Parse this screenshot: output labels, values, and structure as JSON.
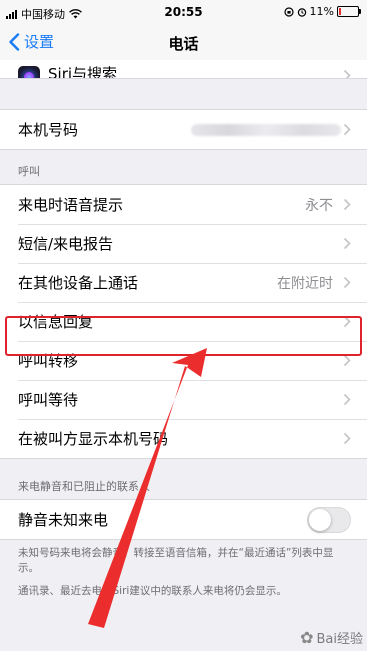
{
  "status_bar": {
    "carrier": "中国移动",
    "time": "20:55",
    "battery_percent": "11%",
    "battery_level": 0.11,
    "battery_color": "#e03030"
  },
  "nav": {
    "back_label": "设置",
    "title": "电话"
  },
  "top_group": {
    "siri_row_label": "Siri与搜索"
  },
  "number_group": {
    "my_number_label": "本机号码"
  },
  "calls_section": {
    "header": "呼叫",
    "rows": [
      {
        "label": "来电时语音提示",
        "value": "永不"
      },
      {
        "label": "短信/来电报告",
        "value": ""
      },
      {
        "label": "在其他设备上通话",
        "value": "在附近时"
      },
      {
        "label": "以信息回复",
        "value": ""
      },
      {
        "label": "呼叫转移",
        "value": ""
      },
      {
        "label": "呼叫等待",
        "value": ""
      },
      {
        "label": "在被叫方显示本机号码",
        "value": ""
      }
    ]
  },
  "silence_section": {
    "header": "来电静音和已阻止的联系人",
    "toggle_label": "静音未知来电",
    "toggle_on": false,
    "footer_1": "未知号码来电将会静音，转接至语音信箱，并在“最近通话”列表中显示。",
    "footer_2": "通讯录、最近去电和Siri建议中的联系人来电将仍会显示。"
  },
  "annotation": {
    "highlight_color": "#e0222a"
  },
  "watermark": {
    "text": "Bai经验"
  },
  "colors": {
    "accent": "#1a7cf5",
    "background": "#efeff4",
    "secondary_text": "#8e8e93"
  }
}
